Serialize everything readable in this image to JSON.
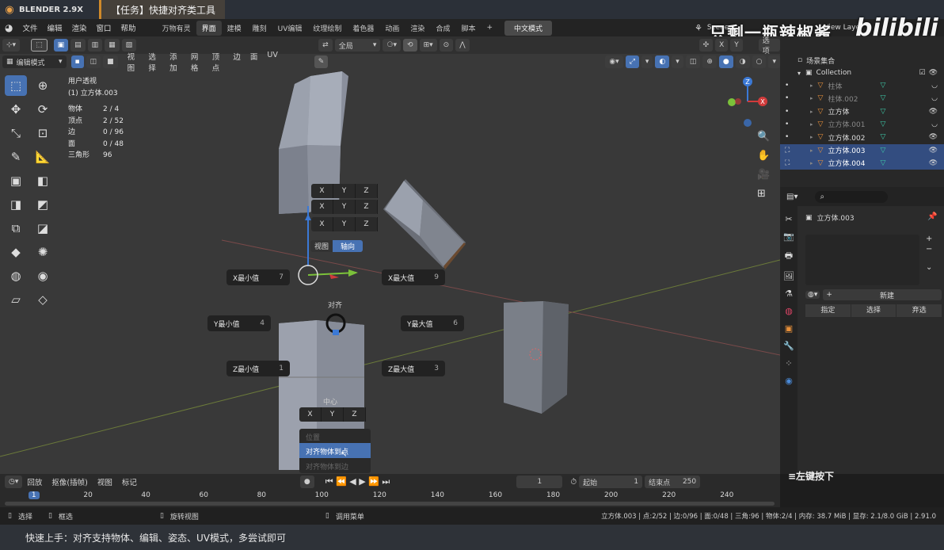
{
  "title_bar": {
    "brand": "BLENDER 2.9X",
    "task": "【任务】快捷对齐类工具"
  },
  "menu": {
    "items": [
      "文件",
      "编辑",
      "渲染",
      "窗口",
      "帮助"
    ]
  },
  "workspaces": [
    {
      "label": "万物有灵",
      "active": false
    },
    {
      "label": "界面",
      "active": true
    },
    {
      "label": "建模",
      "active": false
    },
    {
      "label": "雕刻",
      "active": false
    },
    {
      "label": "UV编辑",
      "active": false
    },
    {
      "label": "纹理绘制",
      "active": false
    },
    {
      "label": "着色器",
      "active": false
    },
    {
      "label": "动画",
      "active": false
    },
    {
      "label": "渲染",
      "active": false
    },
    {
      "label": "合成",
      "active": false
    },
    {
      "label": "脚本",
      "active": false
    }
  ],
  "lang_button": "中文模式",
  "scene_label": "Scene",
  "view_layer": "View Layer",
  "watermark": "只剩一瓶辣椒酱",
  "bilibili": "bilibili",
  "header": {
    "transform_orientation": "全局",
    "options": "选项",
    "mode": "编辑模式",
    "view_menu": [
      "视图",
      "选择",
      "添加",
      "网格",
      "顶点",
      "边",
      "面",
      "UV"
    ]
  },
  "stats": {
    "view_name": "用户透视",
    "object_name": "(1) 立方体.003",
    "rows": [
      {
        "k": "物体",
        "v": "2 / 4"
      },
      {
        "k": "顶点",
        "v": "2 / 52"
      },
      {
        "k": "边",
        "v": "0 / 96"
      },
      {
        "k": "面",
        "v": "0 / 48"
      },
      {
        "k": "三角形",
        "v": "96"
      }
    ]
  },
  "gizmo": {
    "z": "Z",
    "x": "X"
  },
  "pie": {
    "xyz": [
      "X",
      "Y",
      "Z"
    ],
    "view_label": "视图",
    "axis_label": "轴向",
    "align_label": "对齐",
    "center_label": "中心",
    "x_min": "X最小值",
    "x_min_key": "7",
    "x_max": "X最大值",
    "x_max_key": "9",
    "y_min": "Y最小值",
    "y_min_key": "4",
    "y_max": "Y最大值",
    "y_max_key": "6",
    "z_min": "Z最小值",
    "z_min_key": "1",
    "z_max": "Z最大值",
    "z_max_key": "3",
    "position_item": "位置",
    "align_to_point": "对齐物体到点",
    "align_to_edge": "对齐物体到边"
  },
  "outliner": {
    "root": "场景集合",
    "collection": "Collection",
    "items": [
      {
        "label": "柱体",
        "selected": false,
        "dim": true
      },
      {
        "label": "柱体.002",
        "selected": false,
        "dim": true
      },
      {
        "label": "立方体",
        "selected": false,
        "dim": false
      },
      {
        "label": "立方体.001",
        "selected": false,
        "dim": true
      },
      {
        "label": "立方体.002",
        "selected": false,
        "dim": false
      },
      {
        "label": "立方体.003",
        "selected": true,
        "dim": false
      },
      {
        "label": "立方体.004",
        "selected": true,
        "dim": false
      }
    ]
  },
  "properties": {
    "object": "立方体.003",
    "new_button": "新建",
    "assign": "指定",
    "select": "选择",
    "deselect": "弃选",
    "left_press": "≡左键按下"
  },
  "timeline": {
    "menus": [
      "回放",
      "抠像(插帧)",
      "视图",
      "标记"
    ],
    "current_frame": "1",
    "start_label": "起始",
    "start": "1",
    "end_label": "结束点",
    "end": "250",
    "ticks": [
      "1",
      "20",
      "40",
      "60",
      "80",
      "100",
      "120",
      "140",
      "160",
      "180",
      "200",
      "220",
      "240"
    ]
  },
  "status_bar": {
    "select": "选择",
    "box": "框选",
    "rotate": "旋转视图",
    "call_menu": "调用菜单",
    "info": "立方体.003 | 点:2/52 | 边:0/96 | 面:0/48 | 三角:96 | 物体:2/4 | 内存: 38.7 MiB | 显存: 2.1/8.0 GiB | 2.91.0"
  },
  "caption": "快速上手：对齐支持物体、编辑、姿态、UV模式，多尝试即可",
  "colors": {
    "accent": "#4772b3",
    "selected_row": "#334d80",
    "brand": "#e8a04a"
  }
}
